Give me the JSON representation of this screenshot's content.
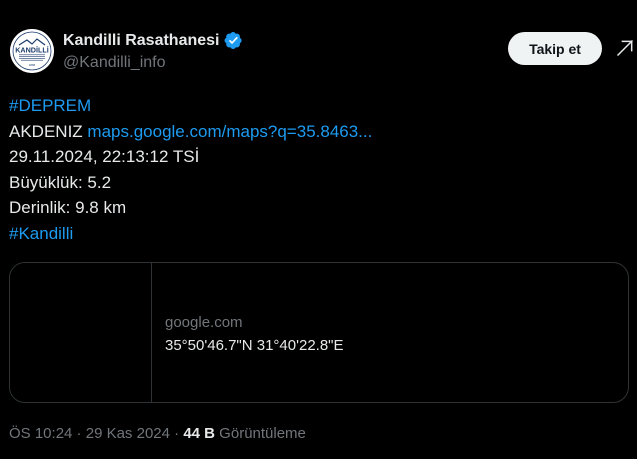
{
  "author": {
    "display_name": "Kandilli Rasathanesi",
    "handle": "@Kandilli_info",
    "avatar_text": "KANDİLLİ",
    "avatar_subtext": "RASATHANESİ VE DEPREM ARAŞTIRMA ENSTİTÜSÜ",
    "avatar_year": "1868",
    "verified_icon": "verified-badge-icon",
    "verified_color": "#1d9bf0"
  },
  "actions": {
    "follow_label": "Takip et",
    "more_icon": "grok-icon"
  },
  "tweet": {
    "hashtag1": "#DEPREM",
    "location_label": "AKDENIZ",
    "maps_link": "maps.google.com/maps?q=35.8463...",
    "datetime": "29.11.2024, 22:13:12 TSİ",
    "magnitude": "Büyüklük: 5.2",
    "depth": "Derinlik: 9.8 km",
    "hashtag2": "#Kandilli"
  },
  "card": {
    "domain": "google.com",
    "title": "35°50'46.7\"N 31°40'22.8\"E"
  },
  "meta": {
    "time": "ÖS 10:24",
    "separator1": " · ",
    "date": "29 Kas 2024",
    "separator2": " · ",
    "views_count": "44 B",
    "views_label": " Görüntüleme"
  },
  "colors": {
    "background": "#000000",
    "text": "#e7e9ea",
    "secondary": "#71767b",
    "link": "#1d9bf0",
    "border": "#2f3336"
  }
}
